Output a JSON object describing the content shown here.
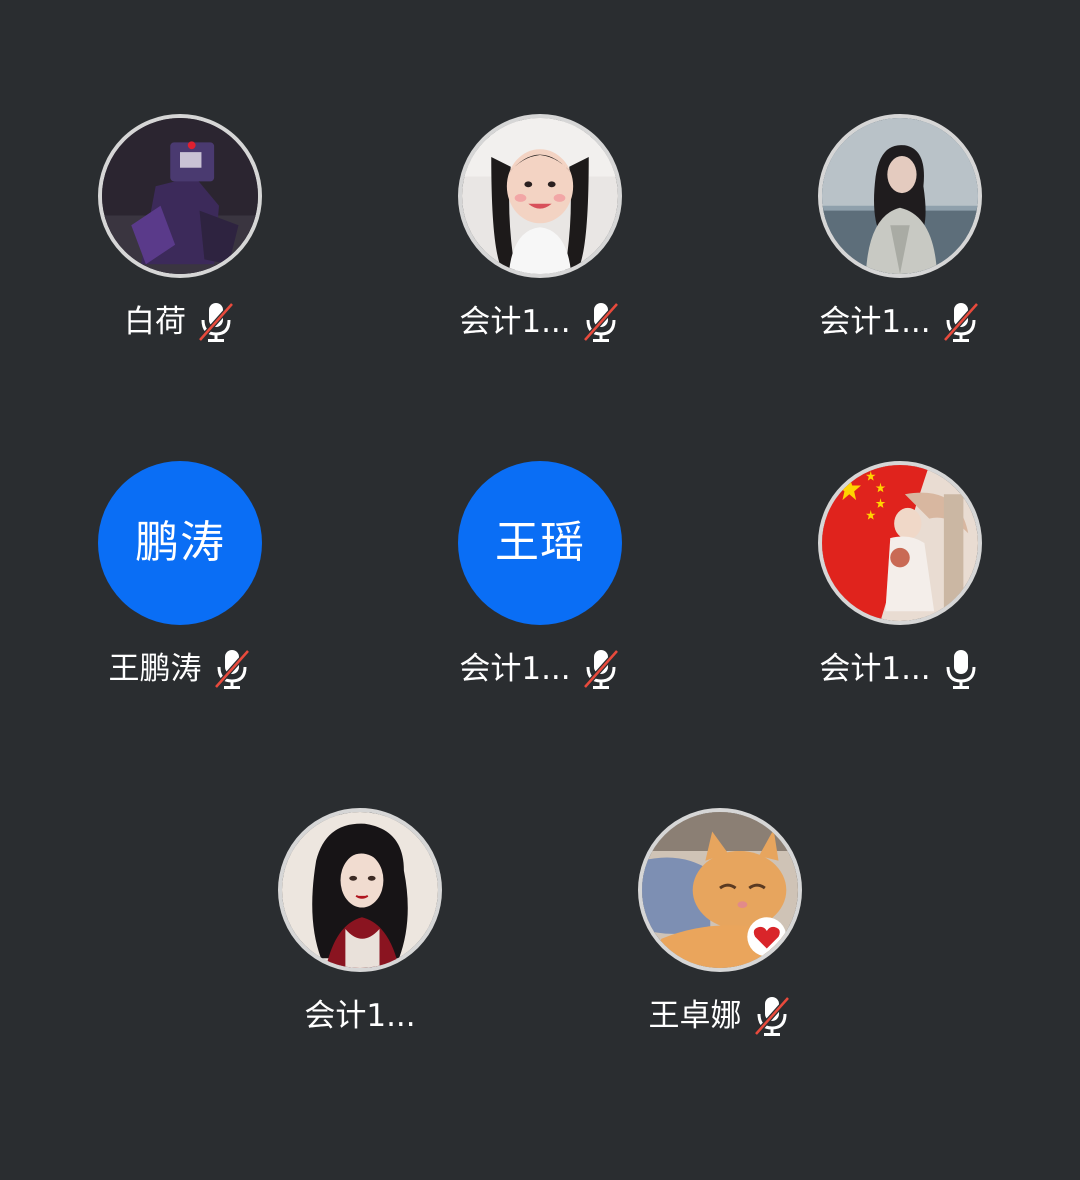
{
  "participants": [
    {
      "name": "白荷",
      "avatar_icon": "robot-avatar-icon",
      "mic": "muted"
    },
    {
      "name": "会计1...",
      "avatar_icon": "girl-pigtails-avatar-icon",
      "mic": "muted"
    },
    {
      "name": "会计1...",
      "avatar_icon": "girl-seaside-avatar-icon",
      "mic": "muted"
    },
    {
      "name": "王鹏涛",
      "initials": "鹏涛",
      "mic": "muted"
    },
    {
      "name": "会计1...",
      "initials": "王瑶",
      "mic": "muted"
    },
    {
      "name": "会计1...",
      "avatar_icon": "flag-girl-avatar-icon",
      "mic": "on"
    },
    {
      "name": "会计1...",
      "avatar_icon": "woman-illustration-avatar-icon",
      "mic": "none"
    },
    {
      "name": "王卓娜",
      "avatar_icon": "kitten-avatar-icon",
      "mic": "muted"
    }
  ],
  "colors": {
    "background": "#2a2d30",
    "initials_avatar": "#0a6ef5",
    "avatar_border": "#d6d6d6",
    "mute_slash": "#e84a3c",
    "text": "#ffffff"
  }
}
